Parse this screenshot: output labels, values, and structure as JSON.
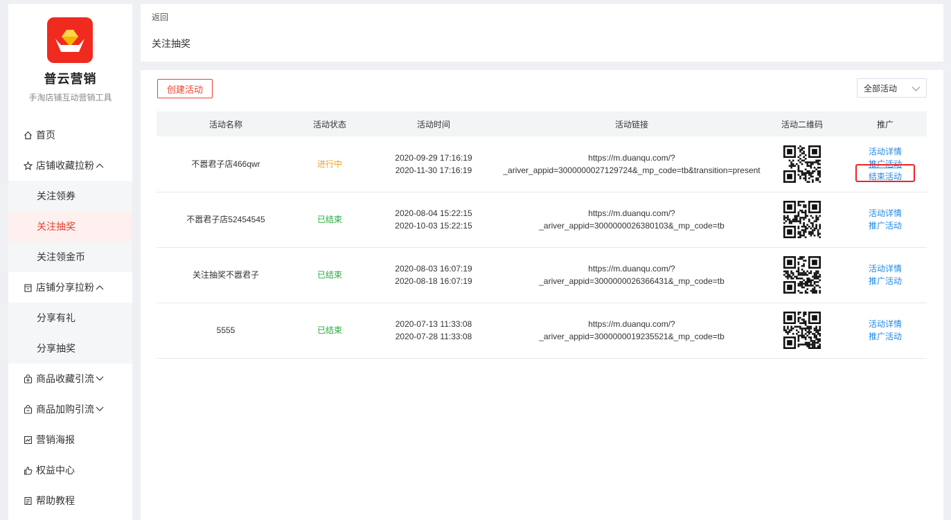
{
  "app": {
    "brand": "普云营销",
    "slogan": "手淘店铺互动营销工具",
    "colors": {
      "accent": "#e9402f",
      "link": "#1e88e5",
      "running": "#f1a31b",
      "ended": "#22ac38"
    }
  },
  "sidebar": {
    "items": [
      {
        "label": "首页",
        "icon": "home-icon"
      },
      {
        "label": "店铺收藏拉粉",
        "icon": "star-icon",
        "expanded": true,
        "children": [
          {
            "label": "关注领券"
          },
          {
            "label": "关注抽奖",
            "active": true
          },
          {
            "label": "关注领金币"
          }
        ]
      },
      {
        "label": "店铺分享拉粉",
        "icon": "shop-icon",
        "expanded": true,
        "children": [
          {
            "label": "分享有礼"
          },
          {
            "label": "分享抽奖"
          }
        ]
      },
      {
        "label": "商品收藏引流",
        "icon": "bag-icon",
        "expanded": false
      },
      {
        "label": "商品加购引流",
        "icon": "cart-bag-icon",
        "expanded": false
      },
      {
        "label": "营销海报",
        "icon": "poster-icon"
      },
      {
        "label": "权益中心",
        "icon": "thumb-icon"
      },
      {
        "label": "帮助教程",
        "icon": "doc-icon"
      }
    ]
  },
  "header": {
    "back": "返回",
    "title": "关注抽奖"
  },
  "toolbar": {
    "create": "创建活动",
    "filter_value": "全部活动"
  },
  "table": {
    "columns": [
      "活动名称",
      "活动状态",
      "活动时间",
      "活动链接",
      "活动二维码",
      "推广"
    ],
    "rows": [
      {
        "name": "不嚣君子店466qwr",
        "status": "进行中",
        "start": "2020-09-29 17:16:19",
        "end": "2020-11-30 17:16:19",
        "link1": "https://m.duanqu.com/?",
        "link2": "_ariver_appid=3000000027129724&_mp_code=tb&transition=present",
        "ops": [
          "活动详情",
          "推广活动",
          "结束活动"
        ]
      },
      {
        "name": "不嚣君子店52454545",
        "status": "已结束",
        "start": "2020-08-04 15:22:15",
        "end": "2020-10-03 15:22:15",
        "link1": "https://m.duanqu.com/?",
        "link2": "_ariver_appid=3000000026380103&_mp_code=tb",
        "ops": [
          "活动详情",
          "推广活动"
        ]
      },
      {
        "name": "关注抽奖不嚣君子",
        "status": "已结束",
        "start": "2020-08-03 16:07:19",
        "end": "2020-08-18 16:07:19",
        "link1": "https://m.duanqu.com/?",
        "link2": "_ariver_appid=3000000026366431&_mp_code=tb",
        "ops": [
          "活动详情",
          "推广活动"
        ]
      },
      {
        "name": "5555",
        "status": "已结束",
        "start": "2020-07-13 11:33:08",
        "end": "2020-07-28 11:33:08",
        "link1": "https://m.duanqu.com/?",
        "link2": "_ariver_appid=3000000019235521&_mp_code=tb",
        "ops": [
          "活动详情",
          "推广活动"
        ]
      }
    ]
  }
}
